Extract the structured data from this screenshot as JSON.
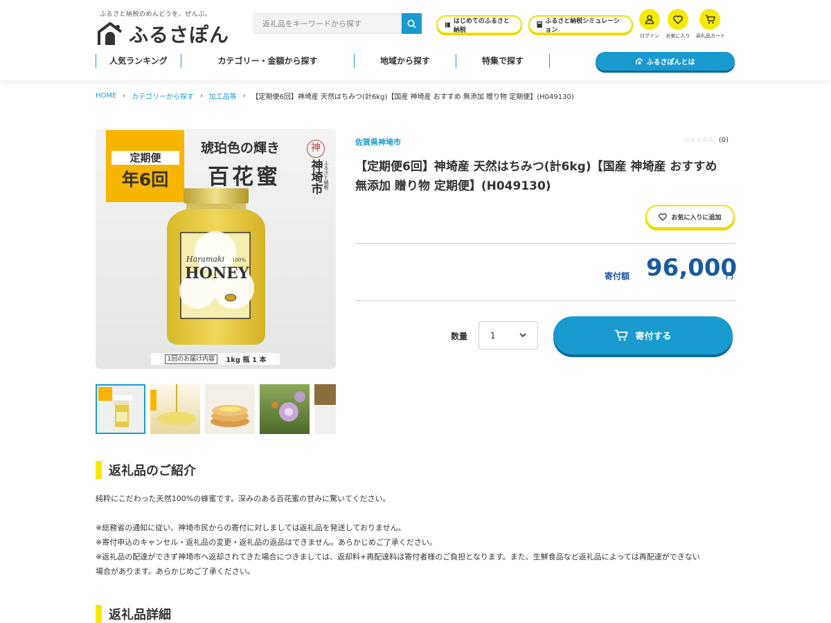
{
  "header": {
    "tagline": "ふるさと納税のめんどうを、ぜんぶ。",
    "logo_text": "ふるさぽん",
    "search_placeholder": "返礼品をキーワードから探す",
    "guide_button": "はじめてのふるさと納税",
    "simulation_button": "ふるさと納税シミュレーション",
    "login_label": "ログイン",
    "favorites_label": "お気に入り",
    "cart_label": "返礼品カート",
    "about_button": "ふるさぽんとは"
  },
  "nav": {
    "items": [
      {
        "label": "人気ランキング"
      },
      {
        "label": "カテゴリー・金額から探す"
      },
      {
        "label": "地域から探す"
      },
      {
        "label": "特集で探す"
      }
    ]
  },
  "breadcrumb": {
    "home": "HOME",
    "category": "カテゴリーから探す",
    "subcategory": "加工品等",
    "current": "【定期便6回】神埼産 天然はちみつ(計6kg)【国産 神埼産 おすすめ 無添加 贈り物 定期便】(H049130)"
  },
  "image": {
    "badge_top": "定期便",
    "badge_main": "年6回",
    "tagline": "琥珀色の輝き",
    "honey_name": "百花蜜",
    "city_char": "神",
    "city_name": "神埼市",
    "city_sub": "ふるさと納税",
    "label_brand": "Haramaki",
    "label_pct": "100%",
    "label_honey": "HONEY",
    "delivery_label": "1回のお届け内容",
    "delivery_value": "1kg 瓶 1 本"
  },
  "product": {
    "region": "佐賀県神埼市",
    "stars": "☆☆☆☆☆",
    "rating_count": "(0)",
    "title": "【定期便6回】神埼産 天然はちみつ(計6kg)【国産 神埼産 おすすめ 無添加 贈り物 定期便】(H049130)",
    "favorite_button": "お気に入りに追加",
    "price_label": "寄付額",
    "price_value": "96,000",
    "price_unit": "円",
    "qty_label": "数量",
    "qty_value": "1",
    "donate_button": "寄付する"
  },
  "intro": {
    "heading": "返礼品のご紹介",
    "line1": "純粋にこだわった天然100%の蜂蜜です。深みのある百花蜜の甘みに驚いてください。",
    "line2": "※総務省の通知に従い、神埼市民からの寄付に対しましては返礼品を発送しておりません。",
    "line3": "※寄付申込のキャンセル・返礼品の変更・返礼品の返品はできません。あらかじめご了承ください。",
    "line4": "※返礼品の配達ができず神埼市へ返却されてきた場合につきましては、返却料+再配達料は寄付者様のご負担となります。また、生鮮食品など返礼品によっては再配達ができない",
    "line5": "場合があります。あらかじめご了承ください。"
  },
  "details": {
    "heading": "返礼品詳細"
  },
  "colors": {
    "accent_blue": "#1a9bd0",
    "accent_yellow": "#f7ea00",
    "price_blue": "#1a5a9c",
    "badge_orange": "#f7b500"
  }
}
